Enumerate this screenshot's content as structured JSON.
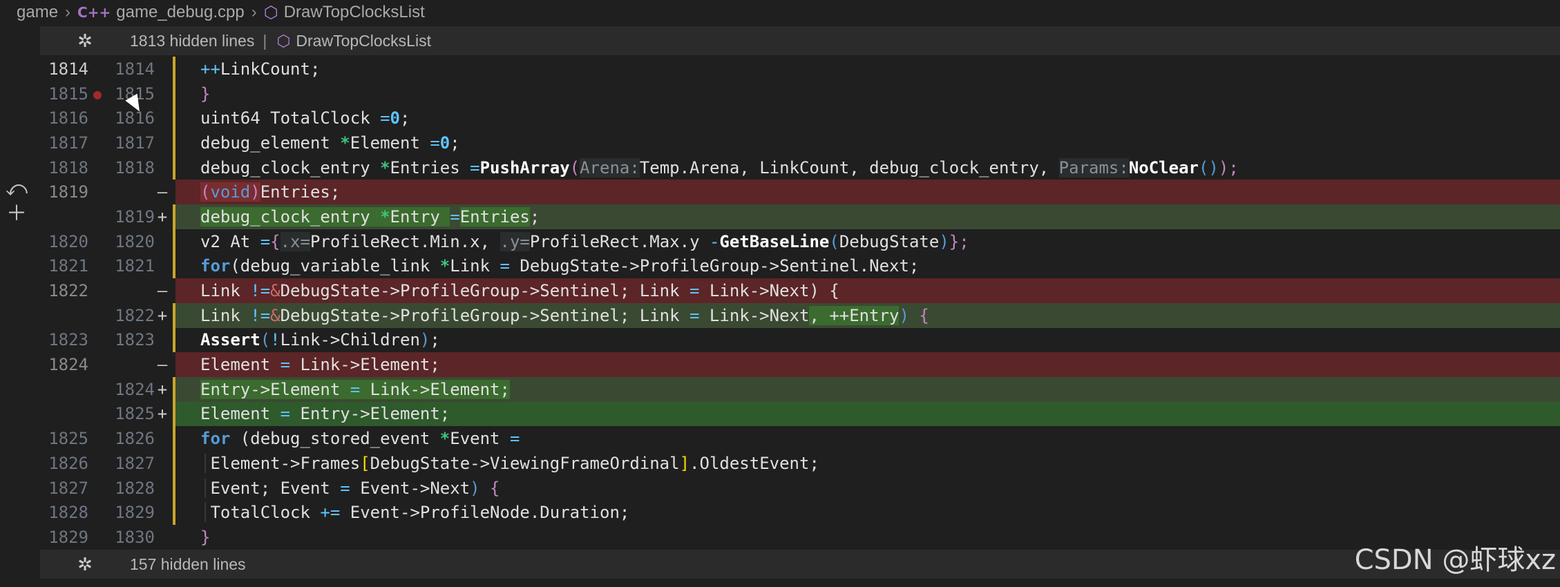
{
  "breadcrumb": {
    "folder": "game",
    "file_icon": "C++",
    "file": "game_debug.cpp",
    "symbol": "DrawTopClocksList"
  },
  "fold_top": {
    "text": "1813 hidden lines",
    "separator": "|",
    "symbol": "DrawTopClocksList"
  },
  "fold_bottom": {
    "text": "157 hidden lines"
  },
  "gutter_actions": [
    "revert-icon",
    "stage-icon"
  ],
  "lines": [
    {
      "old": "1814",
      "new": "1814",
      "marker": "",
      "type": "ctx"
    },
    {
      "old": "1815",
      "new": "1815",
      "marker": "",
      "type": "ctx",
      "breakpoint": true
    },
    {
      "old": "1816",
      "new": "1816",
      "marker": "",
      "type": "ctx"
    },
    {
      "old": "1817",
      "new": "1817",
      "marker": "",
      "type": "ctx"
    },
    {
      "old": "1818",
      "new": "1818",
      "marker": "",
      "type": "ctx"
    },
    {
      "old": "1819",
      "new": "",
      "marker": "—",
      "type": "removed"
    },
    {
      "old": "",
      "new": "1819",
      "marker": "+",
      "type": "added"
    },
    {
      "old": "1820",
      "new": "1820",
      "marker": "",
      "type": "ctx"
    },
    {
      "old": "1821",
      "new": "1821",
      "marker": "",
      "type": "ctx"
    },
    {
      "old": "1822",
      "new": "",
      "marker": "—",
      "type": "removed"
    },
    {
      "old": "",
      "new": "1822",
      "marker": "+",
      "type": "added"
    },
    {
      "old": "1823",
      "new": "1823",
      "marker": "",
      "type": "ctx"
    },
    {
      "old": "1824",
      "new": "",
      "marker": "—",
      "type": "removed"
    },
    {
      "old": "",
      "new": "1824",
      "marker": "+",
      "type": "added"
    },
    {
      "old": "",
      "new": "1825",
      "marker": "+",
      "type": "added-strong"
    },
    {
      "old": "1825",
      "new": "1826",
      "marker": "",
      "type": "ctx"
    },
    {
      "old": "1826",
      "new": "1827",
      "marker": "",
      "type": "ctx"
    },
    {
      "old": "1827",
      "new": "1828",
      "marker": "",
      "type": "ctx"
    },
    {
      "old": "1828",
      "new": "1829",
      "marker": "",
      "type": "ctx"
    },
    {
      "old": "1829",
      "new": "1830",
      "marker": "",
      "type": "ctx"
    }
  ],
  "code": {
    "l0_a": "++",
    "l0_b": "LinkCount;",
    "l1": "}",
    "l2_a": "uint64 TotalClock ",
    "l2_b": "=",
    "l2_c": "0",
    "l2_d": ";",
    "l3_a": "debug_element ",
    "l3_b": "*",
    "l3_c": "Element ",
    "l3_d": "=",
    "l3_e": "0",
    "l3_f": ";",
    "l4_a": "debug_clock_entry ",
    "l4_b": "*",
    "l4_c": "Entries ",
    "l4_d": "=",
    "l4_e": "PushArray",
    "l4_f": "(",
    "l4_g": "Arena:",
    "l4_h": "Temp.Arena, LinkCount, debug_clock_entry, ",
    "l4_i": "Params:",
    "l4_j": "NoClear",
    "l4_k": "()",
    "l4_l": ");",
    "l5_a": "(",
    "l5_b": "void",
    "l5_c": ")",
    "l5_d": "Entries;",
    "l6_a": "debug_clock_entry ",
    "l6_b": "*",
    "l6_c": "Entry ",
    "l6_d": "=",
    "l6_e": "Entries",
    "l6_f": ";",
    "l7_a": "v2 At ",
    "l7_b": "=",
    "l7_c": "{",
    "l7_d": ".x=",
    "l7_e": "ProfileRect.Min.x, ",
    "l7_f": ".y=",
    "l7_g": "ProfileRect.Max.y ",
    "l7_h": "-",
    "l7_i": "GetBaseLine",
    "l7_j": "(",
    "l7_k": "DebugState",
    "l7_l": ")",
    "l7_m": "};",
    "l8_a": "for",
    "l8_b": "(debug_variable_link ",
    "l8_c": "*",
    "l8_d": "Link ",
    "l8_e": "=",
    "l8_f": " DebugState->ProfileGroup->Sentinel.Next;",
    "l9_a": "Link ",
    "l9_b": "!=",
    "l9_c": "&",
    "l9_d": "DebugState->ProfileGroup->Sentinel; Link ",
    "l9_e": "=",
    "l9_f": " Link->Next) {",
    "l10_a": "Link ",
    "l10_b": "!=",
    "l10_c": "&",
    "l10_d": "DebugState->ProfileGroup->Sentinel; Link ",
    "l10_e": "=",
    "l10_f": " Link->Next",
    "l10_g": ", ++Entry",
    "l10_h": ")",
    "l10_i": " {",
    "l11_a": "Assert",
    "l11_b": "(",
    "l11_c": "!",
    "l11_d": "Link->Children",
    "l11_e": ")",
    "l11_f": ";",
    "l12_a": "Element ",
    "l12_b": "=",
    "l12_c": " Link->Element;",
    "l13_a": "Entry->Element ",
    "l13_b": "=",
    "l13_c": " Link->Element;",
    "l14_a": "Element ",
    "l14_b": "=",
    "l14_c": " Entry->Element;",
    "l15_a": "for",
    "l15_b": " (debug_stored_event ",
    "l15_c": "*",
    "l15_d": "Event ",
    "l15_e": "=",
    "l16_a": "Element->Frames",
    "l16_b": "[",
    "l16_c": "DebugState->ViewingFrameOrdinal",
    "l16_d": "]",
    "l16_e": ".OldestEvent;",
    "l17_a": "Event; Event ",
    "l17_b": "=",
    "l17_c": " Event->Next",
    "l17_d": ")",
    "l17_e": " {",
    "l18_a": "TotalClock ",
    "l18_b": "+=",
    "l18_c": " Event->ProfileNode.Duration;",
    "l19": "}"
  },
  "watermark": "CSDN @虾球xz",
  "colors": {
    "removed": "#5c2527",
    "added": "#3a4a32",
    "accent_yellow": "#c9a52b"
  }
}
